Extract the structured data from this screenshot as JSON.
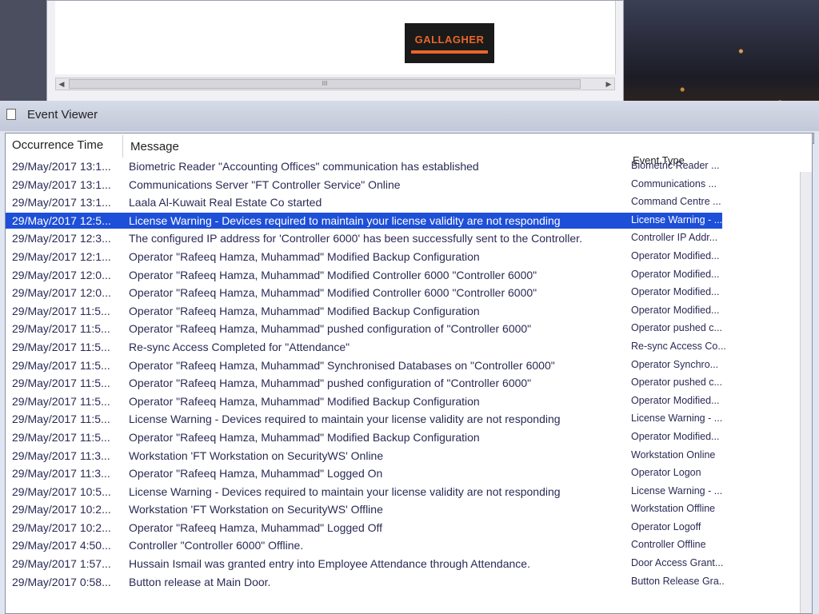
{
  "browser": {
    "logo_text": "GALLAGHER",
    "scroll_grip": "III",
    "scroll_left_arrow": "◀",
    "scroll_right_arrow": "▶"
  },
  "event_viewer": {
    "title": "Event Viewer",
    "columns": {
      "time": "Occurrence Time",
      "message": "Message",
      "type": "Event Type"
    },
    "window_buttons": [
      "—",
      "□",
      "✕"
    ],
    "rows": [
      {
        "time": "29/May/2017 13:1...",
        "message": "Biometric Reader \"Accounting Offices\" communication has established",
        "type": "Biometric Reader ..."
      },
      {
        "time": "29/May/2017 13:1...",
        "message": "Communications Server \"FT Controller Service\" Online",
        "type": "Communications ..."
      },
      {
        "time": "29/May/2017 13:1...",
        "message": "Laala Al-Kuwait Real Estate Co started",
        "type": "Command Centre ..."
      },
      {
        "time": "29/May/2017 12:5...",
        "message": "License Warning - Devices required to maintain your license validity are not responding",
        "type": "License Warning - ...",
        "selected": true
      },
      {
        "time": "29/May/2017 12:3...",
        "message": "The configured IP address for 'Controller 6000' has been successfully sent to the Controller.",
        "type": "Controller IP Addr..."
      },
      {
        "time": "29/May/2017 12:1...",
        "message": "Operator \"Rafeeq Hamza, Muhammad\" Modified Backup Configuration",
        "type": "Operator Modified..."
      },
      {
        "time": "29/May/2017 12:0...",
        "message": "Operator \"Rafeeq Hamza, Muhammad\" Modified Controller 6000 \"Controller 6000\"",
        "type": "Operator Modified..."
      },
      {
        "time": "29/May/2017 12:0...",
        "message": "Operator \"Rafeeq Hamza, Muhammad\" Modified Controller 6000 \"Controller 6000\"",
        "type": "Operator Modified..."
      },
      {
        "time": "29/May/2017 11:5...",
        "message": "Operator \"Rafeeq Hamza, Muhammad\" Modified Backup Configuration",
        "type": "Operator Modified..."
      },
      {
        "time": "29/May/2017 11:5...",
        "message": "Operator \"Rafeeq Hamza, Muhammad\" pushed configuration of \"Controller 6000\"",
        "type": "Operator pushed c..."
      },
      {
        "time": "29/May/2017 11:5...",
        "message": "Re-sync Access Completed for \"Attendance\"",
        "type": "Re-sync Access Co..."
      },
      {
        "time": "29/May/2017 11:5...",
        "message": "Operator \"Rafeeq Hamza, Muhammad\" Synchronised Databases on \"Controller 6000\"",
        "type": "Operator Synchro..."
      },
      {
        "time": "29/May/2017 11:5...",
        "message": "Operator \"Rafeeq Hamza, Muhammad\" pushed configuration of \"Controller 6000\"",
        "type": "Operator pushed c..."
      },
      {
        "time": "29/May/2017 11:5...",
        "message": "Operator \"Rafeeq Hamza, Muhammad\" Modified Backup Configuration",
        "type": "Operator Modified..."
      },
      {
        "time": "29/May/2017 11:5...",
        "message": "License Warning - Devices required to maintain your license validity are not responding",
        "type": "License Warning - ..."
      },
      {
        "time": "29/May/2017 11:5...",
        "message": "Operator \"Rafeeq Hamza, Muhammad\" Modified Backup Configuration",
        "type": "Operator Modified..."
      },
      {
        "time": "29/May/2017 11:3...",
        "message": "Workstation 'FT Workstation on SecurityWS' Online",
        "type": "Workstation Online"
      },
      {
        "time": "29/May/2017 11:3...",
        "message": "Operator \"Rafeeq Hamza, Muhammad\" Logged On",
        "type": "Operator Logon"
      },
      {
        "time": "29/May/2017 10:5...",
        "message": "License Warning - Devices required to maintain your license validity are not responding",
        "type": "License Warning - ..."
      },
      {
        "time": "29/May/2017 10:2...",
        "message": "Workstation 'FT Workstation on SecurityWS' Offline",
        "type": "Workstation Offline"
      },
      {
        "time": "29/May/2017 10:2...",
        "message": "Operator \"Rafeeq Hamza, Muhammad\" Logged Off",
        "type": "Operator Logoff"
      },
      {
        "time": "29/May/2017 4:50...",
        "message": "Controller \"Controller 6000\" Offline.",
        "type": "Controller Offline"
      },
      {
        "time": "29/May/2017 1:57...",
        "message": "Hussain Ismail was granted entry into Employee Attendance through Attendance.",
        "type": "Door Access Grant..."
      },
      {
        "time": "29/May/2017 0:58...",
        "message": "Button release at Main Door.",
        "type": "Button Release Gra..."
      }
    ]
  }
}
